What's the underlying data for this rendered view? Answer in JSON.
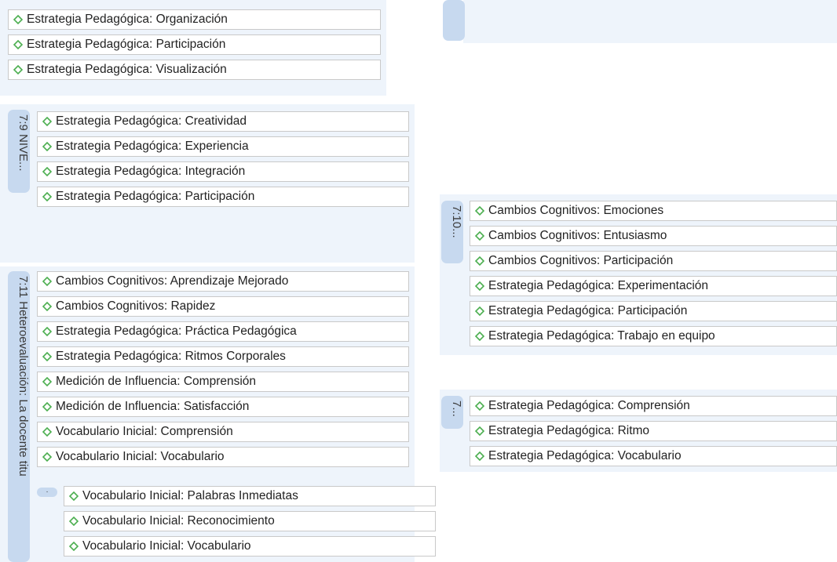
{
  "groups": [
    {
      "id": "g0",
      "label": "",
      "codes": [
        "Estrategia Pedagógica: Organización",
        "Estrategia Pedagógica: Participación",
        "Estrategia Pedagógica: Visualización"
      ]
    },
    {
      "id": "g79",
      "label": "7:9 NIVE...",
      "codes": [
        "Estrategia Pedagógica: Creatividad",
        "Estrategia Pedagógica: Experiencia",
        "Estrategia Pedagógica: Integración",
        "Estrategia Pedagógica: Participación"
      ]
    },
    {
      "id": "g711",
      "label": "7:11 Heteroevaluación: La docente titu",
      "codes": [
        "Cambios Cognitivos: Aprendizaje Mejorado",
        "Cambios Cognitivos: Rapidez",
        "Estrategia Pedagógica: Práctica Pedagógica",
        "Estrategia Pedagógica: Ritmos Corporales",
        "Medición de Influencia: Comprensión",
        "Medición de Influencia: Satisfacción",
        "Vocabulario Inicial: Comprensión",
        "Vocabulario Inicial: Vocabulario"
      ]
    },
    {
      "id": "gsub",
      "label": "·",
      "codes": [
        "Vocabulario Inicial: Palabras Inmediatas",
        "Vocabulario Inicial: Reconocimiento",
        "Vocabulario Inicial: Vocabulario"
      ]
    },
    {
      "id": "g710",
      "label": "7:10...",
      "codes": [
        "Cambios Cognitivos: Emociones",
        "Cambios Cognitivos: Entusiasmo",
        "Cambios Cognitivos: Participación",
        "Estrategia Pedagógica: Experimentación",
        "Estrategia Pedagógica: Participación",
        "Estrategia Pedagógica: Trabajo en equipo"
      ]
    },
    {
      "id": "g7x",
      "label": "7...",
      "codes": [
        "Estrategia Pedagógica: Comprensión",
        "Estrategia Pedagógica: Ritmo",
        "Estrategia Pedagógica: Vocabulario"
      ]
    }
  ],
  "colors": {
    "panel": "#eef4fb",
    "label_tab": "#c7d9ef",
    "code_icon": "#4caf50",
    "code_border": "#c9c9c9"
  },
  "icons": {
    "code": "diamond-code-icon"
  }
}
